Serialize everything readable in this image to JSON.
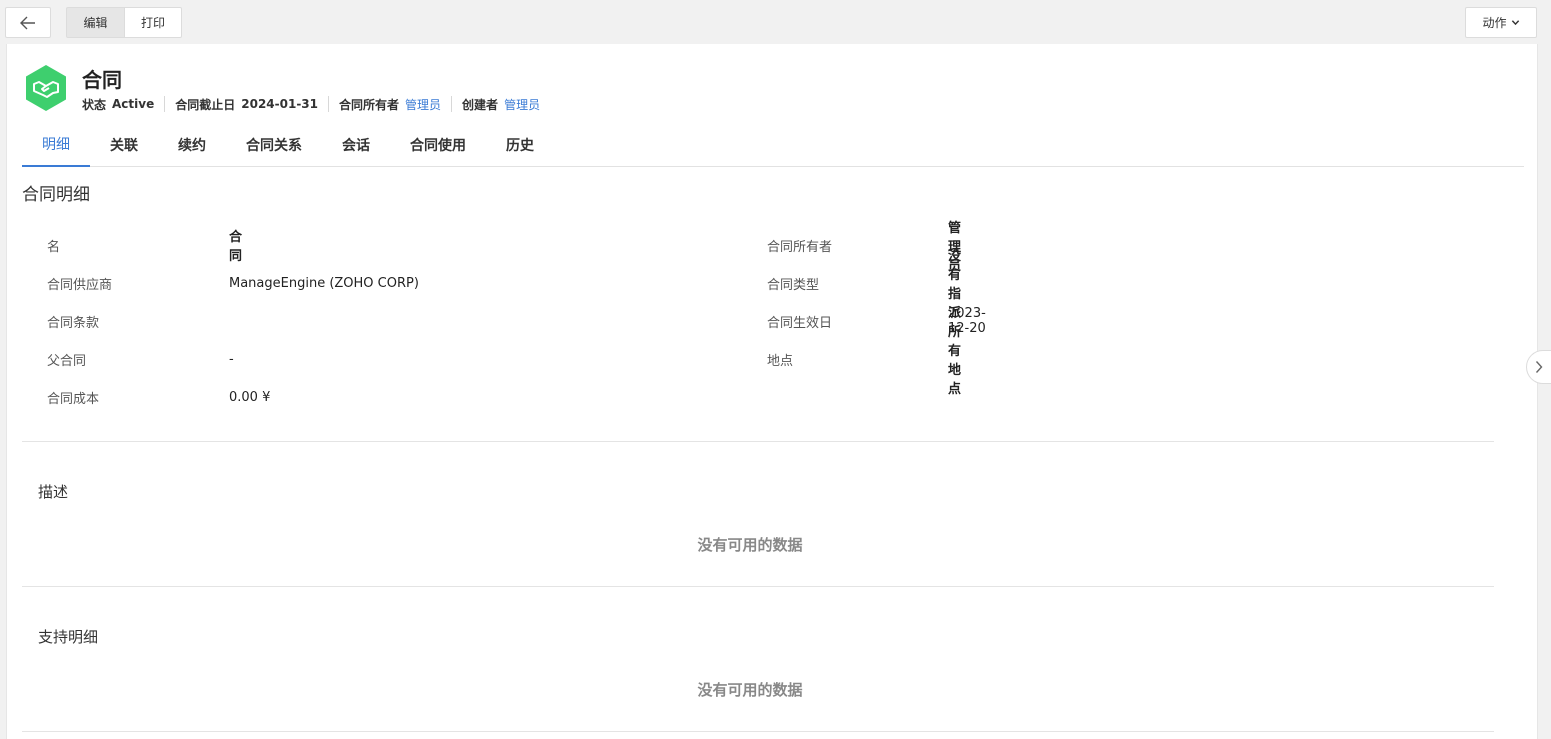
{
  "toolbar": {
    "edit_label": "编辑",
    "print_label": "打印",
    "actions_label": "动作"
  },
  "header": {
    "title": "合同",
    "icon": "handshake-icon",
    "icon_color": "#3ecf6e",
    "meta": {
      "status_key": "状态",
      "status_value": "Active",
      "expiry_key": "合同截止日",
      "expiry_value": "2024-01-31",
      "owner_key": "合同所有者",
      "owner_value": "管理员",
      "creator_key": "创建者",
      "creator_value": "管理员"
    }
  },
  "tabs": [
    "明细",
    "关联",
    "续约",
    "合同关系",
    "会话",
    "合同使用",
    "历史"
  ],
  "details": {
    "section_title": "合同明细",
    "left": [
      {
        "label": "名",
        "value": "合同"
      },
      {
        "label": "合同供应商",
        "value": "ManageEngine (ZOHO CORP)"
      },
      {
        "label": "合同条款",
        "value": ""
      },
      {
        "label": "父合同",
        "value": "-"
      },
      {
        "label": "合同成本",
        "value": "0.00 ¥"
      }
    ],
    "right": [
      {
        "label": "合同所有者",
        "value": "管理员"
      },
      {
        "label": "合同类型",
        "value": "没有指派"
      },
      {
        "label": "合同生效日",
        "value": "2023-12-20"
      },
      {
        "label": "地点",
        "value": "所有地点"
      }
    ]
  },
  "description": {
    "title": "描述",
    "empty_text": "没有可用的数据"
  },
  "support": {
    "title": "支持明细",
    "empty_text": "没有可用的数据"
  },
  "colors": {
    "accent": "#3a7bd5",
    "icon_green": "#3ecf6e"
  }
}
